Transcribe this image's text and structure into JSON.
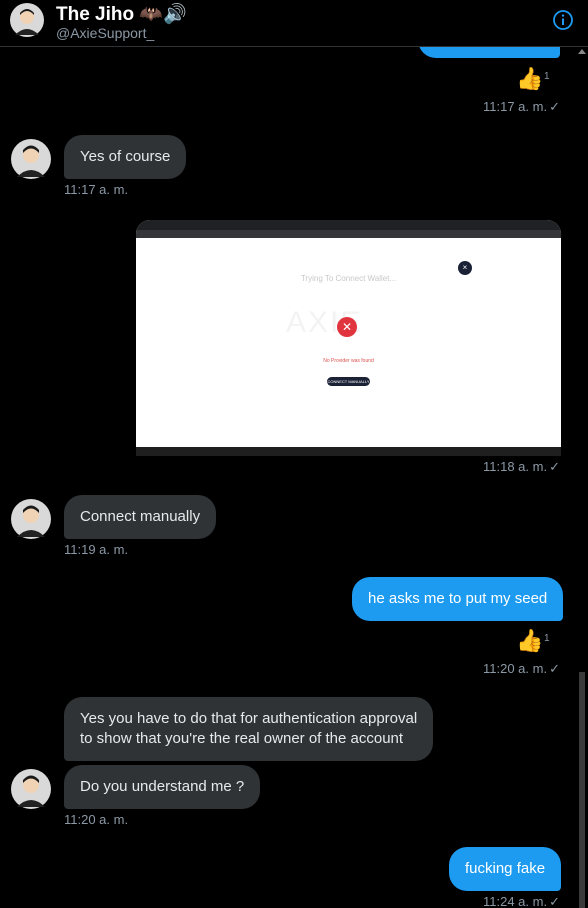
{
  "header": {
    "name": "The Jiho 🦇🔊",
    "handle": "@AxieSupport_"
  },
  "messages": [
    {
      "kind": "reaction",
      "emoji": "👍",
      "count": "1"
    },
    {
      "kind": "timestamp",
      "time": "11:17 a. m.",
      "status": "✓"
    },
    {
      "kind": "incoming",
      "text": "Yes of course",
      "time": "11:17 a. m."
    },
    {
      "kind": "image",
      "time": "11:18 a. m.",
      "status": "✓",
      "content": {
        "title": "Trying To Connect Wallet...",
        "error": "No Provider was found",
        "button": "CONNECT MANUALLY",
        "watermark": "AXIE"
      }
    },
    {
      "kind": "incoming",
      "text": "Connect manually",
      "time": "11:19 a. m."
    },
    {
      "kind": "outgoing",
      "text": "he asks me to put my seed"
    },
    {
      "kind": "reaction",
      "emoji": "👍",
      "count": "1"
    },
    {
      "kind": "timestamp",
      "time": "11:20 a. m.",
      "status": "✓"
    },
    {
      "kind": "incoming",
      "lines": [
        "Yes you have to do that for authentication approval",
        "to show that you're the real owner of the account"
      ]
    },
    {
      "kind": "incoming",
      "text": "Do you understand me ?",
      "time": "11:20 a. m."
    },
    {
      "kind": "outgoing",
      "text": "fucking fake",
      "time": "11:24 a. m.",
      "status": "✓"
    }
  ],
  "colors": {
    "background": "#000000",
    "incoming_bubble": "#2f3336",
    "outgoing_bubble": "#1d9bf0",
    "muted_text": "#8b98a5",
    "accent": "#1d9bf0"
  },
  "icons": {
    "info": "info-icon",
    "check": "check-icon",
    "avatar": "avatar-icon"
  }
}
